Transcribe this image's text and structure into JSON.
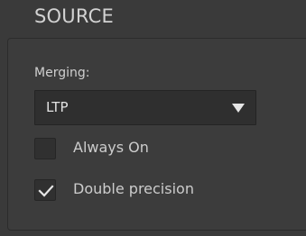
{
  "section": {
    "title": "SOURCE"
  },
  "merging": {
    "label": "Merging:",
    "selected_value": "LTP",
    "arrow_icon": "triangle-down-icon"
  },
  "options": [
    {
      "label": "Always On",
      "checked": false
    },
    {
      "label": "Double precision",
      "checked": true
    }
  ],
  "colors": {
    "background": "#3a3a3a",
    "text": "#d2d2d2",
    "control_bg": "#2f2f2f",
    "check": "#e6e6e6"
  }
}
